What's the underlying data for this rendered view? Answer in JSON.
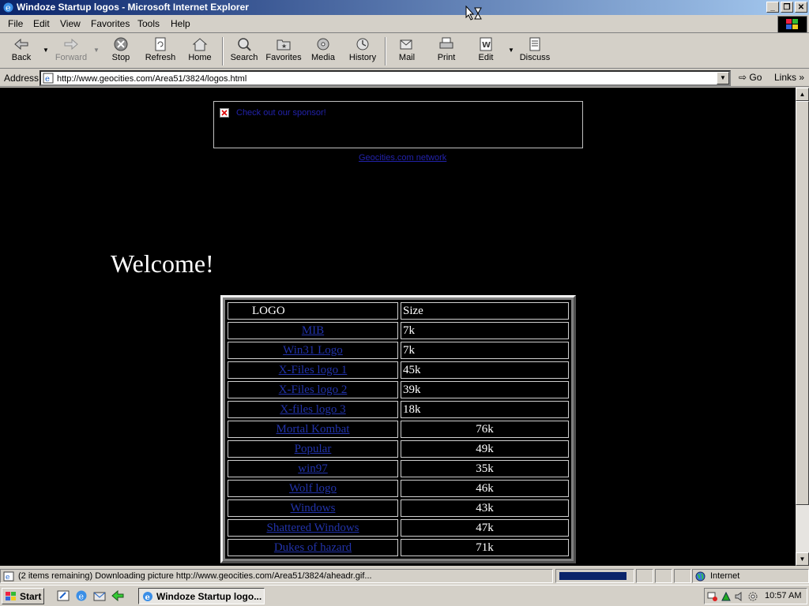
{
  "window": {
    "title": "Windoze Startup logos - Microsoft Internet Explorer"
  },
  "menu": [
    "File",
    "Edit",
    "View",
    "Favorites",
    "Tools",
    "Help"
  ],
  "toolbar": {
    "back": "Back",
    "forward": "Forward",
    "stop": "Stop",
    "refresh": "Refresh",
    "home": "Home",
    "search": "Search",
    "favorites": "Favorites",
    "media": "Media",
    "history": "History",
    "mail": "Mail",
    "print": "Print",
    "edit": "Edit",
    "discuss": "Discuss"
  },
  "address": {
    "label": "Address",
    "url": "http://www.geocities.com/Area51/3824/logos.html",
    "go": "Go",
    "links": "Links"
  },
  "content": {
    "banner_text": "Check out our sponsor!",
    "banner_sub": "Geocities.com network",
    "welcome": "Welcome!",
    "table_header": {
      "logo": "LOGO",
      "size": "Size"
    },
    "rows": [
      {
        "logo": "MIB",
        "size": "7k"
      },
      {
        "logo": "Win31 Logo",
        "size": "7k"
      },
      {
        "logo": "X-Files logo 1",
        "size": "45k"
      },
      {
        "logo": "X-Files logo 2",
        "size": "39k"
      },
      {
        "logo": "X-files logo 3",
        "size": "18k"
      },
      {
        "logo": "Mortal Kombat",
        "size": "76k"
      },
      {
        "logo": "Popular",
        "size": "49k"
      },
      {
        "logo": "win97",
        "size": "35k"
      },
      {
        "logo": "Wolf logo",
        "size": "46k"
      },
      {
        "logo": "Windows",
        "size": "43k"
      },
      {
        "logo": "Shattered Windows",
        "size": "47k"
      },
      {
        "logo": "Dukes of hazard",
        "size": "71k"
      }
    ]
  },
  "status": {
    "text": "(2 items remaining) Downloading picture http://www.geocities.com/Area51/3824/aheadr.gif...",
    "progress": 0.92,
    "zone": "Internet"
  },
  "taskbar": {
    "start": "Start",
    "task": "Windoze Startup logo...",
    "clock": "10:57 AM"
  }
}
